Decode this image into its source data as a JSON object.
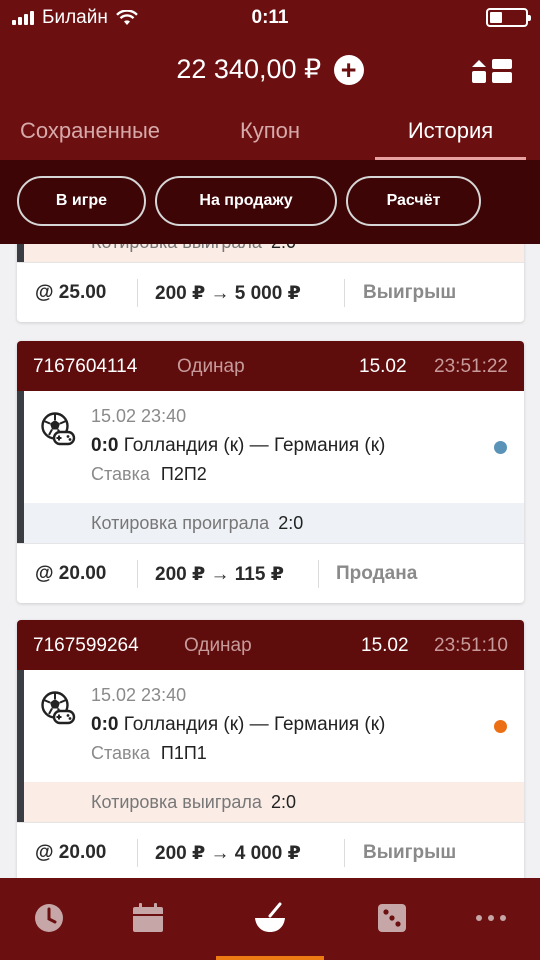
{
  "status_bar": {
    "carrier": "Билайн",
    "time": "0:11"
  },
  "header": {
    "balance": "22 340,00 ₽",
    "add_symbol": "+"
  },
  "tabs": [
    {
      "label": "Сохраненные",
      "active": false
    },
    {
      "label": "Купон",
      "active": false
    },
    {
      "label": "История",
      "active": true
    }
  ],
  "filters": [
    {
      "label": "В игре"
    },
    {
      "label": "На продажу"
    },
    {
      "label": "Расчёт"
    }
  ],
  "cards": [
    {
      "quote_label": "Котировка выиграла",
      "quote_value": "2:0",
      "odds": "@ 25.00",
      "payout": "200 ₽ → 5 000 ₽",
      "status": "Выигрыш"
    },
    {
      "id": "7167604114",
      "type": "Одинар",
      "date": "15.02",
      "time": "23:51:22",
      "event_datetime": "15.02 23:40",
      "score": "0:0",
      "match": "Голландия (к) — Германия (к)",
      "bet_label": "Ставка",
      "bet_value": "П2П2",
      "dot_color": "#5b93b8",
      "quote_label": "Котировка проиграла",
      "quote_value": "2:0",
      "odds": "@ 20.00",
      "payout": "200 ₽ → 115 ₽",
      "status": "Продана"
    },
    {
      "id": "7167599264",
      "type": "Одинар",
      "date": "15.02",
      "time": "23:51:10",
      "event_datetime": "15.02 23:40",
      "score": "0:0",
      "match": "Голландия (к) — Германия (к)",
      "bet_label": "Ставка",
      "bet_value": "П1П1",
      "dot_color": "#ec6f13",
      "quote_label": "Котировка выиграла",
      "quote_value": "2:0",
      "odds": "@ 20.00",
      "payout": "200 ₽ → 4 000 ₽",
      "status": "Выигрыш"
    }
  ],
  "bottom_nav": [
    {
      "icon": "clock-icon",
      "active": false
    },
    {
      "icon": "calendar-icon",
      "active": false
    },
    {
      "icon": "bowl-icon",
      "active": true
    },
    {
      "icon": "dice-icon",
      "active": false
    },
    {
      "icon": "more-icon",
      "active": false
    }
  ],
  "colors": {
    "brand": "#6b0f10",
    "card_header": "#5f0c0d",
    "filter_bar": "#3d0506",
    "active_nav": "#ee7a14"
  }
}
